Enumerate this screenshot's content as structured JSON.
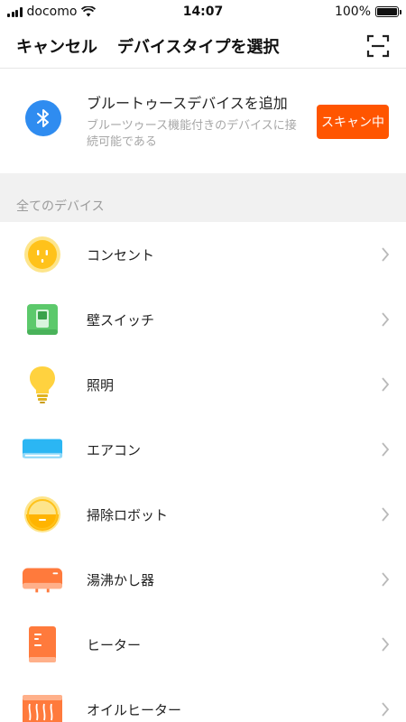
{
  "status_bar": {
    "carrier": "docomo",
    "time": "14:07",
    "battery": "100%"
  },
  "nav": {
    "cancel_label": "キャンセル",
    "title": "デバイスタイプを選択",
    "scan_icon": "scan-icon"
  },
  "bluetooth": {
    "title": "ブルートゥースデバイスを追加",
    "description": "ブルーツゥース機能付きのデバイスに接続可能である",
    "button_label": "スキャン中",
    "icon": "bluetooth-icon",
    "accent_color": "#ff5500"
  },
  "section": {
    "title": "全てのデバイス"
  },
  "devices": [
    {
      "label": "コンセント",
      "icon": "outlet-icon"
    },
    {
      "label": "壁スイッチ",
      "icon": "wall-switch-icon"
    },
    {
      "label": "照明",
      "icon": "light-bulb-icon"
    },
    {
      "label": "エアコン",
      "icon": "air-conditioner-icon"
    },
    {
      "label": "掃除ロボット",
      "icon": "robot-vacuum-icon"
    },
    {
      "label": "湯沸かし器",
      "icon": "water-heater-icon"
    },
    {
      "label": "ヒーター",
      "icon": "heater-icon"
    },
    {
      "label": "オイルヒーター",
      "icon": "oil-heater-icon"
    }
  ]
}
